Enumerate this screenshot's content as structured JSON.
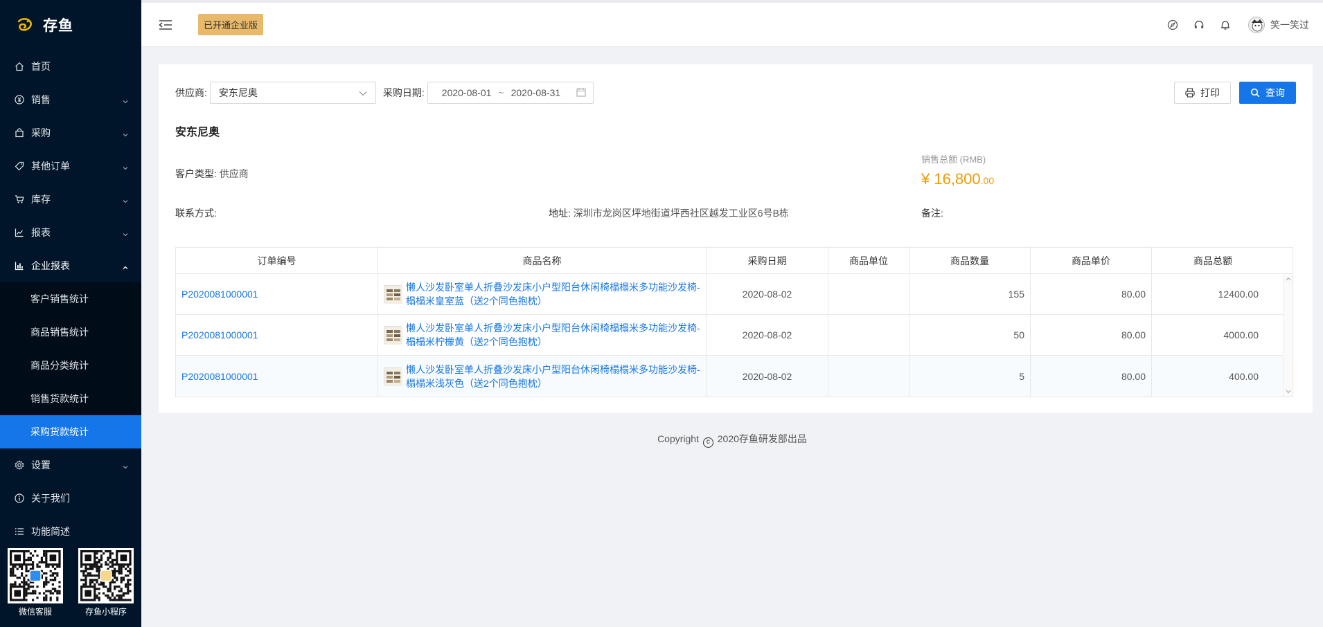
{
  "app": {
    "brand": "存鱼",
    "colors": {
      "sidebar_bg": "#001529",
      "accent": "#1476e8",
      "badge": "#e8b96a",
      "amount": "#f39800"
    }
  },
  "sidebar": {
    "items": [
      {
        "label": "首页",
        "icon": "home-icon",
        "has_children": false
      },
      {
        "label": "销售",
        "icon": "yen-circle-icon",
        "has_children": true
      },
      {
        "label": "采购",
        "icon": "shopping-bag-icon",
        "has_children": true
      },
      {
        "label": "其他订单",
        "icon": "tag-icon",
        "has_children": true
      },
      {
        "label": "库存",
        "icon": "cart-icon",
        "has_children": true
      },
      {
        "label": "报表",
        "icon": "line-chart-icon",
        "has_children": true
      },
      {
        "label": "企业报表",
        "icon": "bar-chart-icon",
        "has_children": true,
        "expanded": true
      }
    ],
    "subitems": [
      {
        "label": "客户销售统计",
        "active": false
      },
      {
        "label": "商品销售统计",
        "active": false
      },
      {
        "label": "商品分类统计",
        "active": false
      },
      {
        "label": "销售货款统计",
        "active": false
      },
      {
        "label": "采购货款统计",
        "active": true
      }
    ],
    "bottom_items": [
      {
        "label": "设置",
        "icon": "gear-icon",
        "has_children": true
      },
      {
        "label": "关于我们",
        "icon": "info-icon",
        "has_children": false
      },
      {
        "label": "功能简述",
        "icon": "list-icon",
        "has_children": false
      }
    ],
    "qr": [
      {
        "label": "微信客服"
      },
      {
        "label": "存鱼小程序"
      }
    ]
  },
  "header": {
    "badge": "已开通企业版",
    "user_name": "笑一笑过"
  },
  "filters": {
    "supplier_label": "供应商:",
    "supplier_value": "安东尼奥",
    "date_label": "采购日期:",
    "date_start": "2020-08-01",
    "date_sep": "~",
    "date_end": "2020-08-31",
    "print_label": "打印",
    "query_label": "查询"
  },
  "summary": {
    "supplier_name": "安东尼奥",
    "customer_type_label": "客户类型:",
    "customer_type_value": "供应商",
    "contact_label": "联系方式:",
    "contact_value": "",
    "address_label": "地址:",
    "address_value": "深圳市龙岗区坪地街道坪西社区越发工业区6号B栋",
    "remark_label": "备注:",
    "remark_value": "",
    "sales_total_label": "销售总额 (RMB)",
    "sales_total_main": "¥ 16,800",
    "sales_total_dec": ".00"
  },
  "table": {
    "columns": [
      "订单编号",
      "商品名称",
      "采购日期",
      "商品单位",
      "商品数量",
      "商品单价",
      "商品总额"
    ],
    "rows": [
      {
        "order_no": "P2020081000001",
        "product": "懒人沙发卧室单人折叠沙发床小户型阳台休闲椅榻榻米多功能沙发椅-榻榻米皇室蓝（送2个同色抱枕）",
        "date": "2020-08-02",
        "unit": "",
        "qty": "155",
        "price": "80.00",
        "total": "12400.00"
      },
      {
        "order_no": "P2020081000001",
        "product": "懒人沙发卧室单人折叠沙发床小户型阳台休闲椅榻榻米多功能沙发椅-榻榻米柠檬黄（送2个同色抱枕）",
        "date": "2020-08-02",
        "unit": "",
        "qty": "50",
        "price": "80.00",
        "total": "4000.00"
      },
      {
        "order_no": "P2020081000001",
        "product": "懒人沙发卧室单人折叠沙发床小户型阳台休闲椅榻榻米多功能沙发椅-榻榻米浅灰色（送2个同色抱枕）",
        "date": "2020-08-02",
        "unit": "",
        "qty": "5",
        "price": "80.00",
        "total": "400.00"
      }
    ]
  },
  "footer": {
    "prefix": "Copyright",
    "symbol": "c",
    "suffix": "2020存鱼研发部出品"
  }
}
